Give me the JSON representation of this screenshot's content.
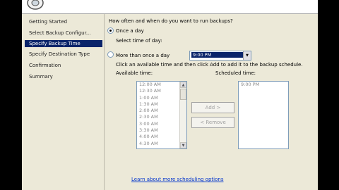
{
  "steps": [
    {
      "label": "Getting Started"
    },
    {
      "label": "Select Backup Configur..."
    },
    {
      "label": "Specify Backup Time"
    },
    {
      "label": "Specify Destination Type"
    },
    {
      "label": "Confirmation"
    },
    {
      "label": "Summary"
    }
  ],
  "main": {
    "question": "How often and when do you want to run backups?",
    "once_label": "Once a day",
    "select_time_label": "Select time of day:",
    "selected_time": "9:00 PM",
    "more_label": "More than once a day",
    "instruction": "Click an available time and then click Add to add it to the backup schedule.",
    "available_label": "Available time:",
    "scheduled_label": "Scheduled time:",
    "available_times": [
      "12:00 AM",
      "12:30 AM",
      "1:00 AM",
      "1:30 AM",
      "2:00 AM",
      "2:30 AM",
      "3:00 AM",
      "3:30 AM",
      "4:00 AM",
      "4:30 AM"
    ],
    "scheduled_times": [
      "9:00 PM"
    ],
    "add_label": "Add >",
    "remove_label": "< Remove",
    "link": "Learn about more scheduling options"
  },
  "colors": {
    "selection": "#0a246a",
    "link": "#0033cc",
    "window": "#ece9d8"
  }
}
